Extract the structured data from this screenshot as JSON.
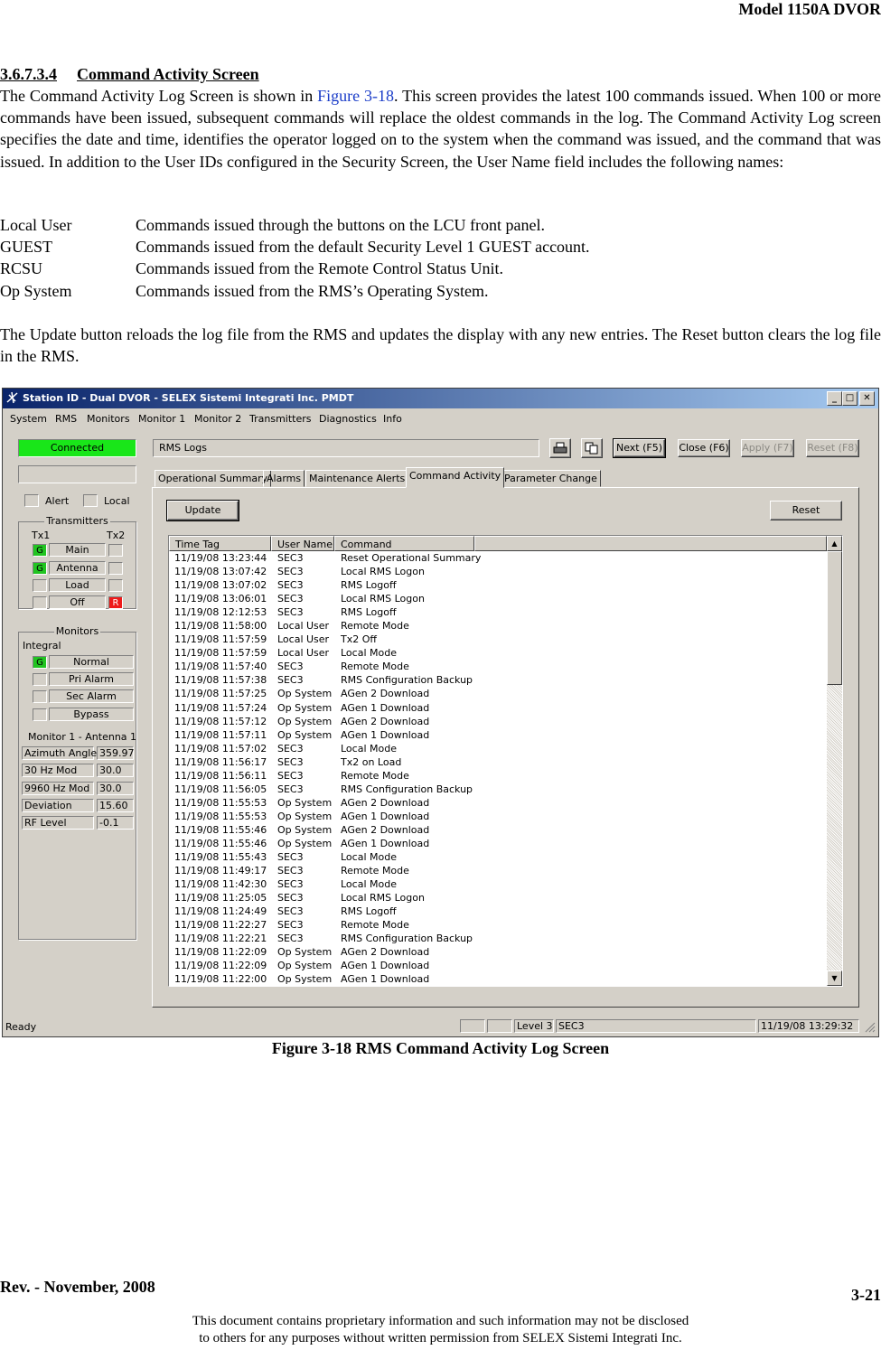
{
  "header": "Model 1150A DVOR",
  "section": {
    "number": "3.6.7.3.4",
    "title": "Command Activity Screen"
  },
  "para1": {
    "pre": "The Command Activity Log Screen is shown in ",
    "link": "Figure 3-18",
    "post": ".  This screen provides the latest 100 commands issued. When 100 or more commands have been issued, subsequent commands will replace the oldest commands in the log. The Command Activity Log screen specifies the date and time, identifies the operator logged on to the system when the command was issued, and the command that was issued. In addition to the User IDs configured in the Security Screen, the User Name field includes the following names:"
  },
  "definitions": [
    {
      "term": "Local User",
      "desc": "Commands issued through the buttons on the LCU front panel."
    },
    {
      "term": "GUEST",
      "desc": "Commands issued from the default Security Level 1 GUEST account."
    },
    {
      "term": "RCSU",
      "desc": "Commands issued from the Remote Control Status Unit."
    },
    {
      "term": "Op System",
      "desc": "Commands issued from the RMS’s Operating System."
    }
  ],
  "para2": "The Update button reloads the log file from the RMS and updates the display with any new entries.  The Reset button clears the log file in the RMS.",
  "screenshot": {
    "title": "Station ID - Dual DVOR - SELEX Sistemi Integrati Inc. PMDT",
    "menu": [
      "System",
      "RMS",
      "Monitors",
      "Monitor 1",
      "Monitor 2",
      "Transmitters",
      "Diagnostics",
      "Info"
    ],
    "connected": "Connected",
    "alert": "Alert",
    "local": "Local",
    "transmitters_label": "Transmitters",
    "tx1": "Tx1",
    "tx2": "Tx2",
    "tx_rows": [
      {
        "label": "Main",
        "left": "G",
        "right": ""
      },
      {
        "label": "Antenna",
        "left": "G",
        "right": ""
      },
      {
        "label": "Load",
        "left": "",
        "right": ""
      },
      {
        "label": "Off",
        "left": "",
        "right": "R"
      }
    ],
    "monitors_label": "Monitors",
    "integral": "Integral",
    "mon_rows": [
      {
        "label": "Normal",
        "ind": "G"
      },
      {
        "label": "Pri Alarm",
        "ind": ""
      },
      {
        "label": "Sec Alarm",
        "ind": ""
      },
      {
        "label": "Bypass",
        "ind": ""
      }
    ],
    "monitor_ant": "Monitor 1 - Antenna 1",
    "measurements": [
      {
        "label": "Azimuth Angle",
        "value": "359.97"
      },
      {
        "label": "30 Hz Mod",
        "value": "30.0"
      },
      {
        "label": "9960 Hz Mod",
        "value": "30.0"
      },
      {
        "label": "Deviation",
        "value": "15.60"
      },
      {
        "label": "RF Level",
        "value": "-0.1"
      }
    ],
    "screen_name": "RMS Logs",
    "buttons": {
      "next": "Next (F5)",
      "close": "Close (F6)",
      "apply": "Apply (F7)",
      "reset_f8": "Reset (F8)"
    },
    "tabs": [
      "Operational Summary",
      "Alarms",
      "Maintenance Alerts",
      "Command Activity",
      "Parameter Change"
    ],
    "update": "Update",
    "reset": "Reset",
    "columns": [
      "Time Tag",
      "User Name",
      "Command"
    ],
    "rows": [
      [
        "11/19/08 13:23:44",
        "SEC3",
        "Reset Operational Summary"
      ],
      [
        "11/19/08 13:07:42",
        "SEC3",
        "Local RMS Logon"
      ],
      [
        "11/19/08 13:07:02",
        "SEC3",
        "RMS Logoff"
      ],
      [
        "11/19/08 13:06:01",
        "SEC3",
        "Local RMS Logon"
      ],
      [
        "11/19/08 12:12:53",
        "SEC3",
        "RMS Logoff"
      ],
      [
        "11/19/08 11:58:00",
        "Local User",
        "Remote Mode"
      ],
      [
        "11/19/08 11:57:59",
        "Local User",
        "Tx2 Off"
      ],
      [
        "11/19/08 11:57:59",
        "Local User",
        "Local Mode"
      ],
      [
        "11/19/08 11:57:40",
        "SEC3",
        "Remote Mode"
      ],
      [
        "11/19/08 11:57:38",
        "SEC3",
        "RMS Configuration Backup"
      ],
      [
        "11/19/08 11:57:25",
        "Op System",
        "AGen 2 Download"
      ],
      [
        "11/19/08 11:57:24",
        "Op System",
        "AGen 1 Download"
      ],
      [
        "11/19/08 11:57:12",
        "Op System",
        "AGen 2 Download"
      ],
      [
        "11/19/08 11:57:11",
        "Op System",
        "AGen 1 Download"
      ],
      [
        "11/19/08 11:57:02",
        "SEC3",
        "Local Mode"
      ],
      [
        "11/19/08 11:56:17",
        "SEC3",
        "Tx2 on Load"
      ],
      [
        "11/19/08 11:56:11",
        "SEC3",
        "Remote Mode"
      ],
      [
        "11/19/08 11:56:05",
        "SEC3",
        "RMS Configuration Backup"
      ],
      [
        "11/19/08 11:55:53",
        "Op System",
        "AGen 2 Download"
      ],
      [
        "11/19/08 11:55:53",
        "Op System",
        "AGen 1 Download"
      ],
      [
        "11/19/08 11:55:46",
        "Op System",
        "AGen 2 Download"
      ],
      [
        "11/19/08 11:55:46",
        "Op System",
        "AGen 1 Download"
      ],
      [
        "11/19/08 11:55:43",
        "SEC3",
        "Local Mode"
      ],
      [
        "11/19/08 11:49:17",
        "SEC3",
        "Remote Mode"
      ],
      [
        "11/19/08 11:42:30",
        "SEC3",
        "Local Mode"
      ],
      [
        "11/19/08 11:25:05",
        "SEC3",
        "Local RMS Logon"
      ],
      [
        "11/19/08 11:24:49",
        "SEC3",
        "RMS Logoff"
      ],
      [
        "11/19/08 11:22:27",
        "SEC3",
        "Remote Mode"
      ],
      [
        "11/19/08 11:22:21",
        "SEC3",
        "RMS Configuration Backup"
      ],
      [
        "11/19/08 11:22:09",
        "Op System",
        "AGen 2 Download"
      ],
      [
        "11/19/08 11:22:09",
        "Op System",
        "AGen 1 Download"
      ],
      [
        "11/19/08 11:22:00",
        "Op System",
        "AGen 1 Download"
      ]
    ],
    "status": {
      "ready": "Ready",
      "level": "Level 3",
      "user": "SEC3",
      "datetime": "11/19/08 13:29:32"
    }
  },
  "caption": "Figure 3-18  RMS Command Activity Log Screen",
  "rev": "Rev. -  November, 2008",
  "page": "3-21",
  "footer_line1": "This document contains proprietary information and such information may not be disclosed",
  "footer_line2": "to others for any purposes without written permission from SELEX Sistemi Integrati Inc.",
  "icons": [
    "app-icon",
    "print-icon",
    "copy-icon",
    "scroll-up-icon",
    "scroll-down-icon",
    "resize-grip-icon"
  ]
}
